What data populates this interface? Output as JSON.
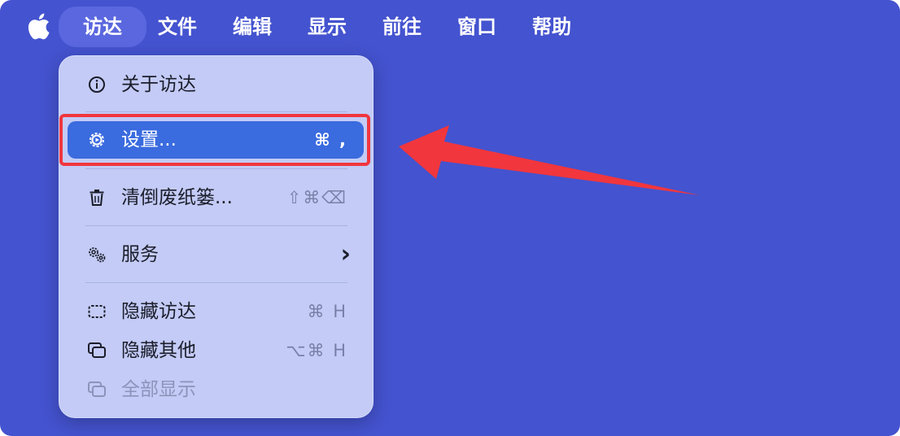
{
  "menubar": {
    "apple_icon": "apple-logo-icon",
    "items": [
      {
        "label": "访达"
      },
      {
        "label": "文件"
      },
      {
        "label": "编辑"
      },
      {
        "label": "显示"
      },
      {
        "label": "前往"
      },
      {
        "label": "窗口"
      },
      {
        "label": "帮助"
      }
    ]
  },
  "menu": {
    "items": [
      {
        "icon": "info-icon",
        "label": "关于访达",
        "shortcut": ""
      },
      {
        "icon": "gear-icon",
        "label": "设置...",
        "shortcut": "⌘ ,"
      },
      {
        "icon": "trash-icon",
        "label": "清倒废纸篓...",
        "shortcut": "⇧⌘⌫"
      },
      {
        "icon": "services-icon",
        "label": "服务",
        "shortcut": "›"
      },
      {
        "icon": "hide-window-icon",
        "label": "隐藏访达",
        "shortcut": "⌘ H"
      },
      {
        "icon": "hide-others-icon",
        "label": "隐藏其他",
        "shortcut": "⌥⌘ H"
      },
      {
        "icon": "show-all-icon",
        "label": "全部显示",
        "shortcut": ""
      }
    ]
  },
  "colors": {
    "background": "#4453cf",
    "menu_background": "#c3cbf6",
    "highlight": "#3a6bdf",
    "annotation": "#f1363d"
  }
}
